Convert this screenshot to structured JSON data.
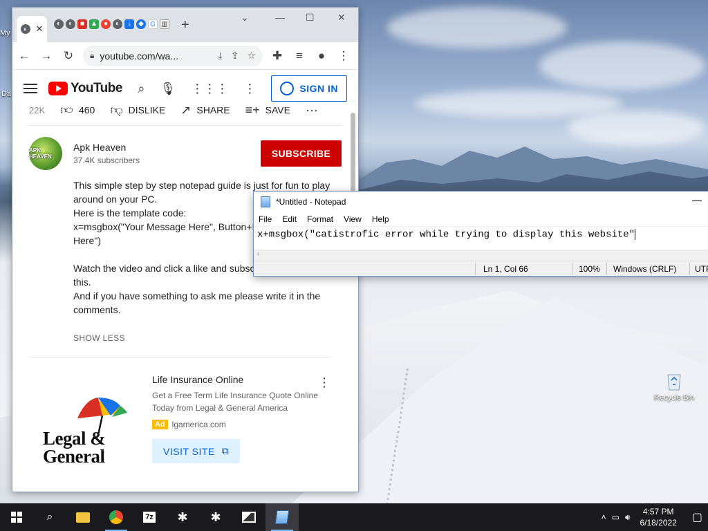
{
  "desktop": {
    "icons": [
      {
        "label": "Recycle Bin",
        "name": "recycle-bin"
      }
    ],
    "partial_labels": [
      "My",
      "Da"
    ]
  },
  "chrome": {
    "address": "youtube.com/wa...",
    "tab_close": "✕",
    "new_tab": "+",
    "window_controls": {
      "menu": "⌄",
      "minimize": "—",
      "maximize": "☐",
      "close": "✕"
    }
  },
  "youtube": {
    "logo_text": "YouTube",
    "sign_in": "SIGN IN",
    "views_partial": "22K",
    "like_count": "460",
    "dislike": "DISLIKE",
    "share": "SHARE",
    "save": "SAVE",
    "channel": {
      "name": "Apk Heaven",
      "subscribers": "37.4K subscribers",
      "avatar_text": "APK HEAVEN"
    },
    "subscribe": "SUBSCRIBE",
    "description": {
      "line1": "This simple step by step notepad guide is just for fun to play around on your PC.",
      "line2": "Here is the template code:",
      "line3": "x=msgbox(\"Your Message Here\", Button+Icon, \"Your Title Here\")",
      "line4": "Watch the video and click a like and subscribe if you like this.",
      "line5": "And if you have something to ask me please write it in the comments."
    },
    "show_less": "SHOW LESS",
    "ad": {
      "title": "Life Insurance Online",
      "description": "Get a Free Term Life Insurance Quote Online Today from Legal & General America",
      "badge": "Ad",
      "domain": "lgamerica.com",
      "button": "VISIT SITE",
      "brand_line1": "Legal &",
      "brand_line2": "General"
    }
  },
  "notepad": {
    "title": "*Untitled - Notepad",
    "menu": [
      "File",
      "Edit",
      "Format",
      "View",
      "Help"
    ],
    "content": "x+msgbox(\"catistrofic error while trying to display this website\"",
    "status": {
      "position": "Ln 1, Col 66",
      "zoom": "100%",
      "line_endings": "Windows (CRLF)",
      "encoding": "UTF"
    }
  },
  "taskbar": {
    "time": "4:57 PM",
    "date": "6/18/2022",
    "apps": [
      "start",
      "search",
      "file-explorer",
      "chrome",
      "7zip",
      "app-bug-1",
      "app-bug-2",
      "photos",
      "notepad"
    ]
  },
  "colors": {
    "youtube_red": "#ff0000",
    "subscribe_red": "#cc0000",
    "link_blue": "#065fd4",
    "taskbar": "#1b1b1f"
  }
}
